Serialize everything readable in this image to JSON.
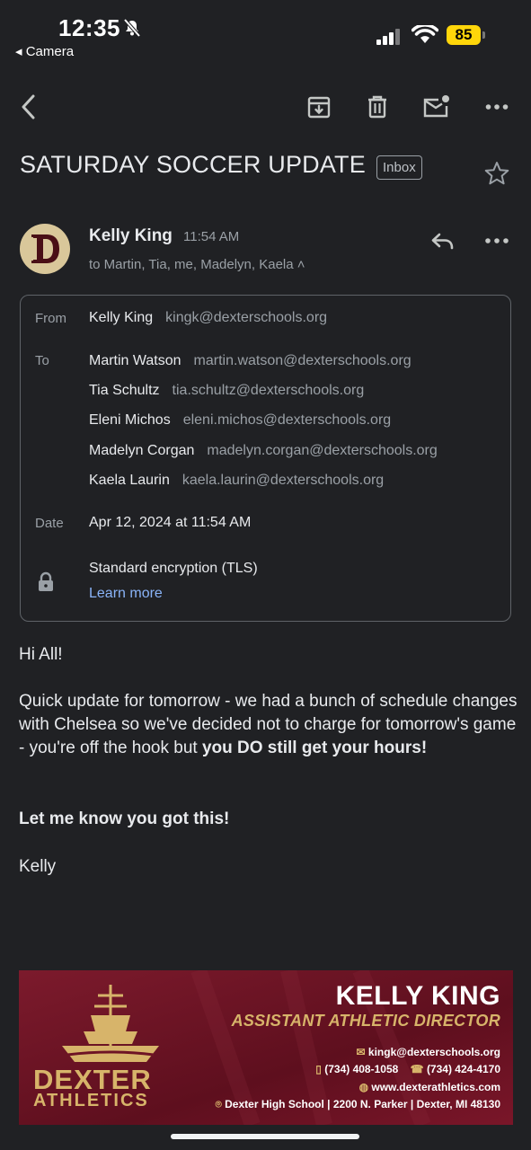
{
  "status": {
    "time": "12:35",
    "back_app": "◂ Camera",
    "battery": "85"
  },
  "toolbar": {
    "icons": [
      "back-icon",
      "archive-icon",
      "trash-icon",
      "mark-unread-icon",
      "more-icon"
    ]
  },
  "email": {
    "subject": "SATURDAY SOCCER UPDATE",
    "label": "Inbox",
    "sender": "Kelly King",
    "time": "11:54 AM",
    "recipients_summary": "to Martin, Tia, me, Madelyn, Kaela ˄",
    "details": {
      "from_label": "From",
      "from": {
        "name": "Kelly King",
        "email": "kingk@dexterschools.org"
      },
      "to_label": "To",
      "to": [
        {
          "name": "Martin Watson",
          "email": "martin.watson@dexterschools.org"
        },
        {
          "name": "Tia Schultz",
          "email": "tia.schultz@dexterschools.org"
        },
        {
          "name": "Eleni Michos",
          "email": "eleni.michos@dexterschools.org"
        },
        {
          "name": "Madelyn Corgan",
          "email": "madelyn.corgan@dexterschools.org"
        },
        {
          "name": "Kaela Laurin",
          "email": "kaela.laurin@dexterschools.org"
        }
      ],
      "date_label": "Date",
      "date": "Apr 12, 2024 at 11:54 AM",
      "encryption": "Standard encryption (TLS)",
      "learn_more": "Learn more"
    },
    "body": {
      "greeting": "Hi All!",
      "para_start": "Quick update for tomorrow - we had a bunch of schedule changes with Chelsea so we've decided not to charge for tomorrow's game - you're off the hook but ",
      "para_bold": "you DO still get your hours!",
      "line2": "Let me know you got this!",
      "signoff": "Kelly"
    }
  },
  "signature": {
    "name": "KELLY KING",
    "title": "ASSISTANT ATHLETIC DIRECTOR",
    "email": "kingk@dexterschools.org",
    "mobile": "(734) 408-1058",
    "phone": "(734) 424-4170",
    "website": "www.dexterathletics.com",
    "address": "Dexter High School | 2200 N. Parker | Dexter, MI 48130",
    "logo_line1": "DEXTER",
    "logo_line2": "ATHLETICS"
  },
  "colors": {
    "background": "#202124",
    "link": "#8ab4f8",
    "signature_bg": "#6e1425",
    "gold": "#d7b46a",
    "battery": "#ffd60a"
  }
}
